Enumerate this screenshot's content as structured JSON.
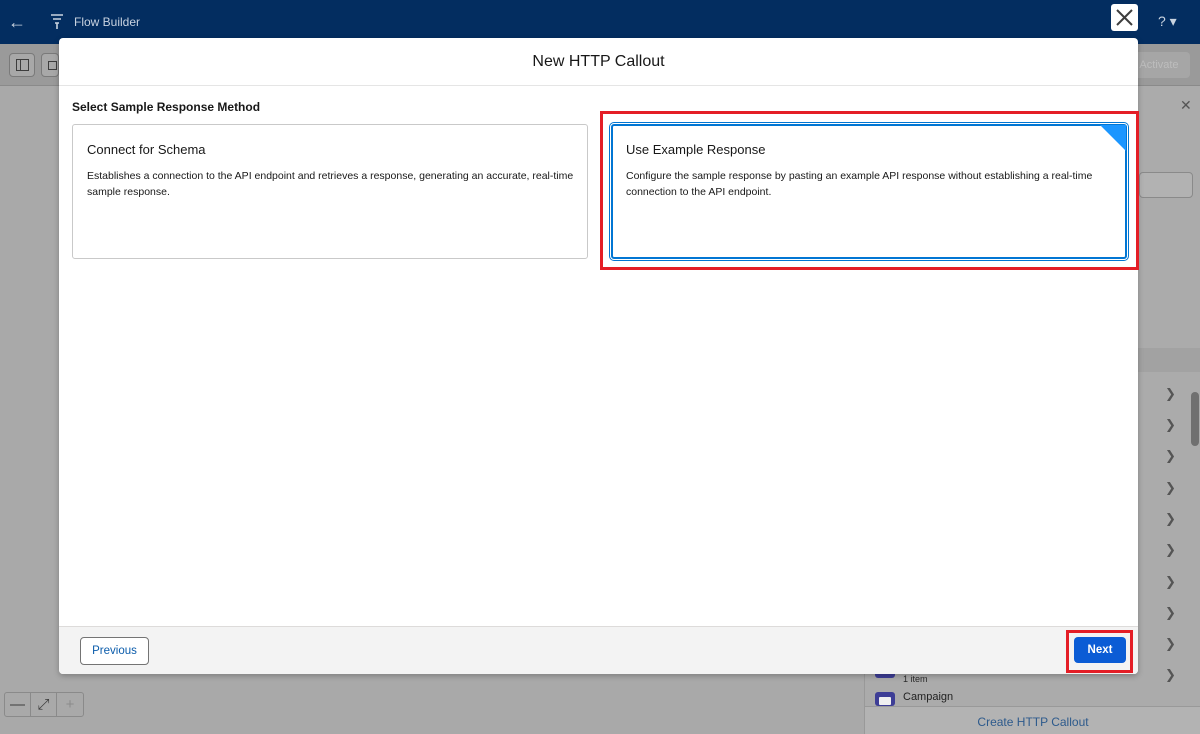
{
  "app": {
    "title": "Flow Builder",
    "activate_label": "Activate",
    "help_label": "?"
  },
  "side_panel": {
    "resource_meta": "1 item",
    "resource_name": "Campaign",
    "create_link": "Create HTTP Callout"
  },
  "modal": {
    "title": "New HTTP Callout",
    "section_title": "Select Sample Response Method",
    "options": [
      {
        "title": "Connect for Schema",
        "description": "Establishes a connection to the API endpoint and retrieves a response, generating an accurate, real-time sample response.",
        "selected": false
      },
      {
        "title": "Use Example Response",
        "description": "Configure the sample response by pasting an example API response without establishing a real-time connection to the API endpoint.",
        "selected": true
      }
    ],
    "previous_label": "Previous",
    "next_label": "Next"
  },
  "colors": {
    "header_bg": "#032d60",
    "brand_blue": "#0176d3",
    "selected_corner": "#1b96ff",
    "next_button": "#0b5cd5",
    "annotation_red": "#e41e26"
  }
}
